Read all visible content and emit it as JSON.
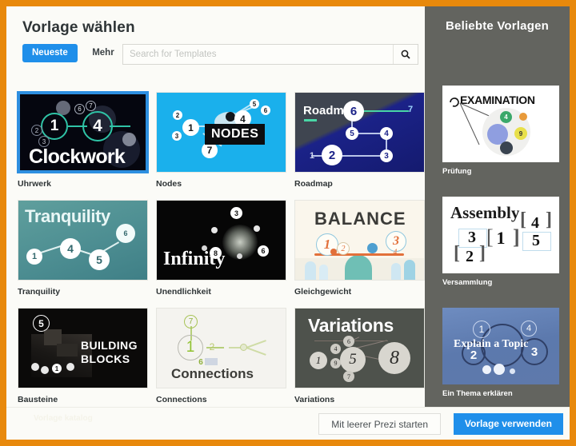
{
  "dialog": {
    "title": "Vorlage wählen",
    "accent_color": "#e8890c",
    "primary_color": "#1f8fea"
  },
  "filters": {
    "active_tab": "Neueste",
    "more_tab": "Mehr"
  },
  "search": {
    "value": "",
    "placeholder": "Search for Templates",
    "icon": "search-icon"
  },
  "templates": [
    {
      "name": "Uhrwerk",
      "art_title": "Clockwork",
      "numbers": [
        "1",
        "4",
        "2",
        "3",
        "6",
        "7"
      ]
    },
    {
      "name": "Nodes",
      "art_title": "NODES",
      "numbers": [
        "1",
        "2",
        "3",
        "4",
        "5",
        "6",
        "7"
      ]
    },
    {
      "name": "Roadmap",
      "art_title": "Roadmap",
      "numbers": [
        "1",
        "2",
        "3",
        "4",
        "5",
        "6",
        "7"
      ]
    },
    {
      "name": "Tranquility",
      "art_title": "Tranquility",
      "numbers": [
        "1",
        "4",
        "5",
        "6"
      ]
    },
    {
      "name": "Unendlichkeit",
      "art_title": "Infinity",
      "numbers": [
        "3",
        "8",
        "6"
      ]
    },
    {
      "name": "Gleichgewicht",
      "art_title": "BALANCE",
      "numbers": [
        "1",
        "2",
        "3",
        "4"
      ]
    },
    {
      "name": "Bausteine",
      "art_title": "BUILDING BLOCKS",
      "numbers": [
        "5",
        "1"
      ]
    },
    {
      "name": "Connections",
      "art_title": "Connections",
      "numbers": [
        "7",
        "1",
        "2",
        "6"
      ]
    },
    {
      "name": "Variations",
      "art_title": "Variations",
      "numbers": [
        "1",
        "5",
        "8",
        "4",
        "6",
        "7",
        "9"
      ]
    }
  ],
  "selected_template_index": 0,
  "popular": {
    "heading": "Beliebte Vorlagen",
    "items": [
      {
        "name": "Prüfung",
        "art_title": "EXAMINATION",
        "numbers": [
          "4",
          "9"
        ]
      },
      {
        "name": "Versammlung",
        "art_title": "Assembly",
        "numbers": [
          "1",
          "2",
          "3",
          "4",
          "5"
        ]
      },
      {
        "name": "Ein Thema erklären",
        "art_title": "Explain a Topic",
        "numbers": [
          "1",
          "2",
          "3",
          "4"
        ]
      }
    ]
  },
  "footer": {
    "blank_prezi_label": "Mit leerer Prezi starten",
    "use_template_label": "Vorlage verwenden",
    "faint_note": "Vorlage katalog"
  }
}
